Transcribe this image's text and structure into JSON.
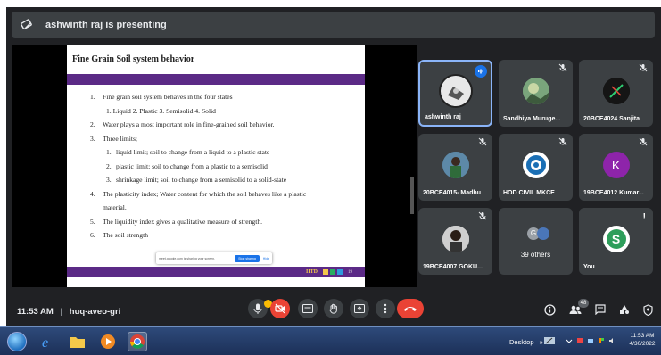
{
  "presenting": {
    "text": "ashwinth raj is presenting"
  },
  "slide": {
    "title": "Fine Grain Soil system behavior",
    "lines": [
      {
        "num": "1.",
        "text": "Fine grain soil system behaves in the four states"
      },
      {
        "num": "",
        "text": "1.  Liquid  2. Plastic  3. Semisolid  4. Solid"
      },
      {
        "num": "2.",
        "text": "Water plays a most important role in fine-grained soil behavior."
      },
      {
        "num": "3.",
        "text": "Three limits;"
      },
      {
        "num": "1.",
        "text": "liquid limit; soil to change from a liquid to a plastic state"
      },
      {
        "num": "2.",
        "text": "plastic limit; soil to change from a plastic to a semisolid"
      },
      {
        "num": "3.",
        "text": "shrinkage limit; soil to change from a semisolid to a solid-state"
      },
      {
        "num": "4.",
        "text": "The plasticity index; Water content for which the soil behaves like a plastic"
      },
      {
        "num": "",
        "text": "material."
      },
      {
        "num": "5.",
        "text": "The liquidity index gives a qualitative measure of strength."
      },
      {
        "num": "6.",
        "text": "The soil strength"
      }
    ],
    "footer_text": "IITD",
    "page_no": "19",
    "share_popup": {
      "message": "meet.google.com is sharing your screen.",
      "stop_label": "Stop sharing",
      "hide_label": "Hide"
    }
  },
  "participants": [
    {
      "name": "ashwinth raj",
      "avatar": "photo-gray",
      "speaking": true
    },
    {
      "name": "Sandhiya Muruge...",
      "avatar": "photo-nature",
      "muted": true
    },
    {
      "name": "20BCE4024 Sanjita",
      "avatar": "photo-dark",
      "muted": true
    },
    {
      "name": "20BCE4015- Madhu",
      "avatar": "photo-outdoor",
      "muted": true
    },
    {
      "name": "HOD CIVIL MKCE",
      "avatar": "logo-blue",
      "muted": true
    },
    {
      "name": "19BCE4012 Kumar...",
      "avatar_letter": "K",
      "avatar_color": "#8e24aa",
      "muted": true
    },
    {
      "name": "19BCE4007 GOKU...",
      "avatar": "photo-person",
      "muted": true
    },
    {
      "name": "",
      "others_label": "39 others",
      "mini_letter": "G"
    },
    {
      "name": "You",
      "avatar_letter": "S",
      "avatar_color": "#2e9e5b",
      "alert": "!"
    }
  ],
  "bottom_bar": {
    "time": "11:53 AM",
    "separator": "|",
    "meeting_code": "huq-aveo-gri",
    "people_count": "48",
    "icons": [
      "mic-icon",
      "camera-off-icon",
      "captions-icon",
      "raise-hand-icon",
      "present-icon",
      "more-icon",
      "hang-up-icon",
      "info-icon",
      "people-icon",
      "chat-icon",
      "activities-icon",
      "host-controls-icon"
    ]
  },
  "taskbar": {
    "desktop_label": "Desktop",
    "chevron": "»",
    "clock_time": "11:53 AM",
    "clock_date": "4/30/2022"
  },
  "colors": {
    "meet_bg": "#202124",
    "tile_bg": "#3c4043",
    "accent_blue": "#1a73e8",
    "danger_red": "#ea4335",
    "slide_band": "#5b2a86"
  }
}
